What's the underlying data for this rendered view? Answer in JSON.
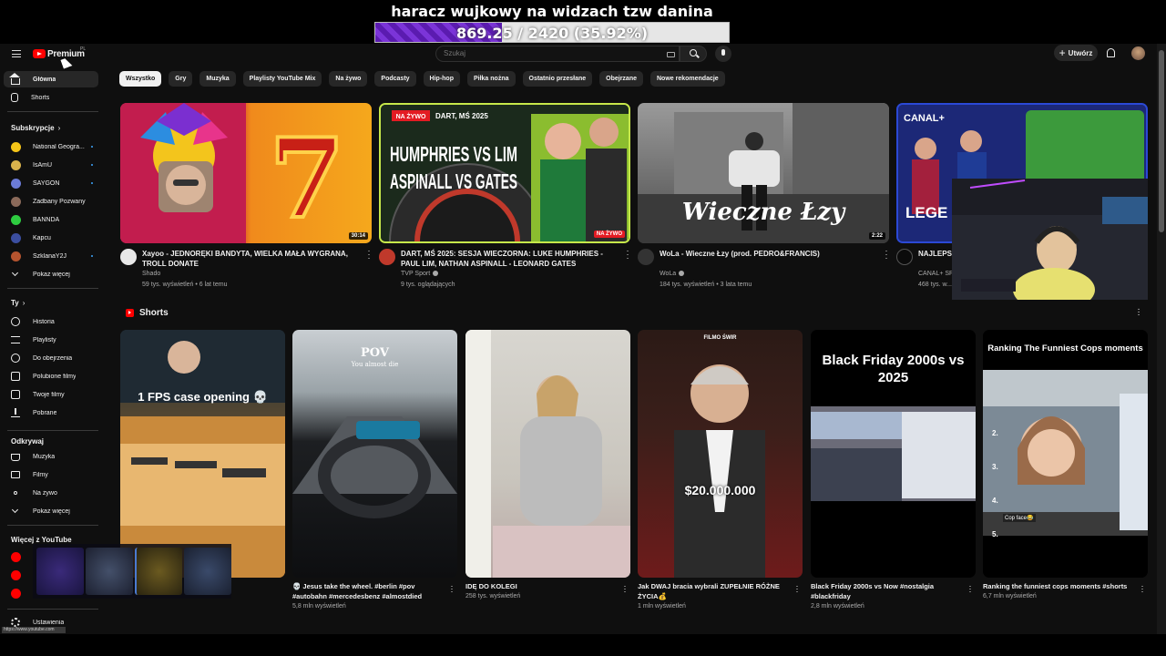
{
  "overlay": {
    "title": "haracz wujkowy na widzach tzw danina",
    "progress_text": "869.25 / 2420 (35.92%)",
    "progress_fraction": 0.3592
  },
  "header": {
    "logo_text": "Premium",
    "region": "PL",
    "search_placeholder": "Szukaj",
    "create_label": "Utwórz"
  },
  "sidebar": {
    "main": [
      {
        "label": "Główna",
        "icon": "home-icon",
        "active": true
      },
      {
        "label": "Shorts",
        "icon": "shorts-icon"
      }
    ],
    "subscriptions_title": "Subskrypcje",
    "subscriptions": [
      {
        "label": "National Geogra...",
        "color": "#f5c518",
        "dot": true
      },
      {
        "label": "IsAmU",
        "color": "#d9b24c",
        "dot": true
      },
      {
        "label": "SAYGON",
        "color": "#6b7bd6",
        "dot": true
      },
      {
        "label": "Zadbany Pozwany",
        "color": "#8b6a5a",
        "dot": false
      },
      {
        "label": "BANNDA",
        "color": "#2ecc40",
        "dot": false
      },
      {
        "label": "Kapcu",
        "color": "#3b4ea0",
        "dot": false
      },
      {
        "label": "SzklanaY2J",
        "color": "#b5542f",
        "dot": true
      }
    ],
    "show_more": "Pokaż więcej",
    "you_title": "Ty",
    "you": [
      {
        "label": "Historia",
        "icon": "history-icon"
      },
      {
        "label": "Playlisty",
        "icon": "playlist-icon"
      },
      {
        "label": "Do obejrzenia",
        "icon": "watch-later-icon"
      },
      {
        "label": "Polubione filmy",
        "icon": "like-icon"
      },
      {
        "label": "Twoje filmy",
        "icon": "your-videos-icon"
      },
      {
        "label": "Pobrane",
        "icon": "download-icon"
      }
    ],
    "explore_title": "Odkrywaj",
    "explore": [
      {
        "label": "Muzyka",
        "icon": "music-icon"
      },
      {
        "label": "Filmy",
        "icon": "film-icon"
      },
      {
        "label": "Na żywo",
        "icon": "live-icon"
      }
    ],
    "explore_more": "Pokaż więcej",
    "more_title": "Więcej z YouTube",
    "settings": "Ustawienia",
    "status_url": "https://www.youtube.com"
  },
  "chips": [
    "Wszystko",
    "Gry",
    "Muzyka",
    "Playlisty YouTube Mix",
    "Na żywo",
    "Podcasty",
    "Hip-hop",
    "Piłka nożna",
    "Ostatnio przesłane",
    "Obejrzane",
    "Nowe rekomendacje"
  ],
  "videos": [
    {
      "title": "Xayoo - JEDNORĘKI BANDYTA, WIELKA MAŁA WYGRANA, TROLL DONATE",
      "channel": "Shado",
      "meta": "59 tys. wyświetleń • 6 lat temu",
      "duration": "30:14",
      "verified": false
    },
    {
      "title": "DART, MŚ 2025: SESJA WIECZORNA: LUKE HUMPHRIES - PAUL LIM, NATHAN ASPINALL - LEONARD GATES",
      "channel": "TVP Sport",
      "meta": "9 tys. oglądających",
      "duration": "NA ŻYWO",
      "verified": true,
      "thumb_text": {
        "badge": "NA ŻYWO",
        "event": "DART, MŚ 2025",
        "line1": "HUMPHRIES VS LIM",
        "line2": "ASPINALL VS GATES"
      }
    },
    {
      "title": "WoLa - Wieczne Łzy (prod. PEDRO&FRANCIS)",
      "channel": "WoLa",
      "meta": "184 tys. wyświetleń • 3 lata temu",
      "duration": "2:22",
      "verified": true,
      "thumb_text": {
        "caption": "Wieczne Łzy"
      }
    },
    {
      "title": "NAJLEPSZ...",
      "channel": "CANAL+ SP...",
      "meta": "468 tys. w...",
      "duration": "",
      "verified": false,
      "thumb_text": {
        "brand": "CANAL+",
        "word": "LEGE"
      }
    }
  ],
  "shorts_title": "Shorts",
  "shorts": [
    {
      "title": "",
      "meta": "",
      "caption": "1 FPS case opening 💀"
    },
    {
      "title": "💀 Jesus take the wheel. #berlin #pov #autobahn #mercedesbenz #almostdied",
      "meta": "5,8 mln wyświetleń",
      "caption": "POV",
      "sub": "You almost die"
    },
    {
      "title": "IDĘ DO KOLEGI",
      "meta": "258 tys. wyświetleń",
      "caption": ""
    },
    {
      "title": "Jak DWAJ bracia wybrali ZUPEŁNIE RÓŻNE ŻYCIA💰",
      "meta": "1 mln wyświetleń",
      "caption": "$20.000.000",
      "brand": "FILMO ŚWIR"
    },
    {
      "title": "Black Friday 2000s vs Now #nostalgia #blackfriday",
      "meta": "2,8 mln wyświetleń",
      "caption": "Black Friday 2000s vs 2025"
    },
    {
      "title": "Ranking the funniest cops moments #shorts",
      "meta": "6,7 mln wyświetleń",
      "caption": "Ranking The Funniest Cops moments",
      "list": [
        "2.",
        "3.",
        "4.",
        "5."
      ],
      "list_note": "Cop face😂"
    }
  ]
}
